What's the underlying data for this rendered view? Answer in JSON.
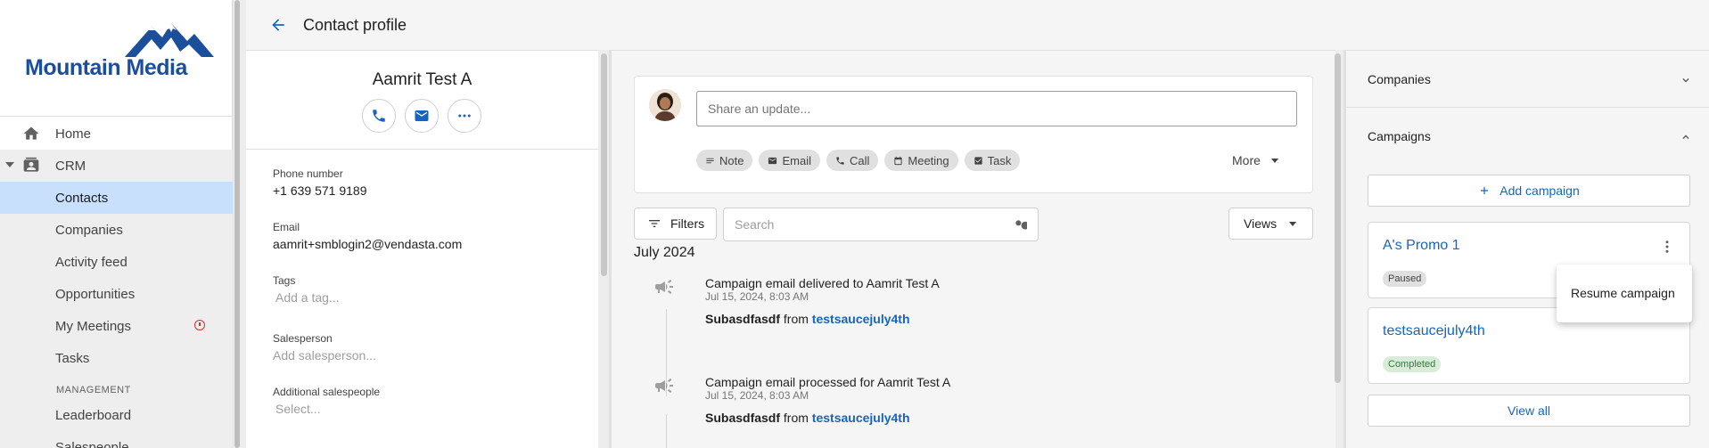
{
  "brand": {
    "logo_text": "Mountain Media",
    "accent": "#1565c0",
    "nav_active": "#c8e0fb"
  },
  "sidebar": {
    "items": [
      {
        "label": "Home",
        "icon": "home-icon"
      },
      {
        "label": "CRM",
        "icon": "crm-icon"
      },
      {
        "label": "Contacts"
      },
      {
        "label": "Companies"
      },
      {
        "label": "Activity feed"
      },
      {
        "label": "Opportunities"
      },
      {
        "label": "My Meetings",
        "badge_icon": "alert-circle-icon"
      },
      {
        "label": "Tasks"
      },
      {
        "label": "Leaderboard"
      },
      {
        "label": "Salespeople"
      }
    ],
    "section_label": "MANAGEMENT"
  },
  "header": {
    "title": "Contact profile",
    "back_icon": "arrow-left-icon"
  },
  "profile": {
    "name": "Aamrit Test A",
    "fields": [
      {
        "label": "Phone number",
        "value": "+1 639 571 9189"
      },
      {
        "label": "Email",
        "value": "aamrit+smblogin2@vendasta.com"
      },
      {
        "label": "Tags",
        "placeholder": "Add a tag..."
      },
      {
        "label": "Salesperson",
        "placeholder": "Add salesperson..."
      },
      {
        "label": "Additional salespeople",
        "placeholder": "Select..."
      }
    ]
  },
  "composer": {
    "placeholder": "Share an update...",
    "chips": [
      "Note",
      "Email",
      "Call",
      "Meeting",
      "Task"
    ],
    "more_label": "More"
  },
  "toolbar": {
    "filters_label": "Filters",
    "search_placeholder": "Search",
    "views_label": "Views"
  },
  "timeline": {
    "month": "July 2024",
    "events": [
      {
        "title": "Campaign email delivered to Aamrit Test A",
        "date": "Jul 15, 2024, 8:03 AM",
        "subject": "Subasdfasdf",
        "from": "from",
        "campaign": "testsaucejuly4th"
      },
      {
        "title": "Campaign email processed for Aamrit Test A",
        "date": "Jul 15, 2024, 8:03 AM",
        "subject": "Subasdfasdf",
        "from": "from",
        "campaign": "testsaucejuly4th"
      }
    ]
  },
  "right_panel": {
    "companies_title": "Companies",
    "campaigns_title": "Campaigns",
    "add_campaign_label": "Add campaign",
    "campaigns": [
      {
        "name": "A's Promo 1",
        "status": "Paused"
      },
      {
        "name": "testsaucejuly4th",
        "status": "Completed"
      }
    ],
    "view_all_label": "View all",
    "menu_item": "Resume campaign"
  }
}
